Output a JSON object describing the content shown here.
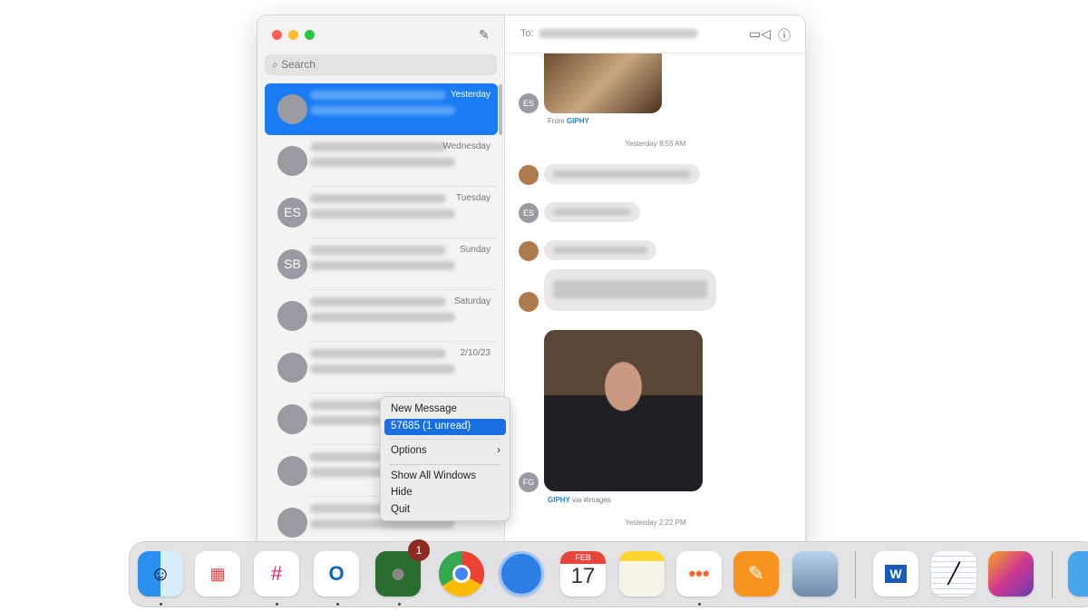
{
  "sidebar": {
    "search_placeholder": "Search",
    "conversations": [
      {
        "date": "Yesterday",
        "avatar": "",
        "selected": true
      },
      {
        "date": "Wednesday",
        "avatar": ""
      },
      {
        "date": "Tuesday",
        "avatar": "ES"
      },
      {
        "date": "Sunday",
        "avatar": "SB"
      },
      {
        "date": "Saturday",
        "avatar": ""
      },
      {
        "date": "2/10/23",
        "avatar": ""
      },
      {
        "date": "",
        "avatar": ""
      },
      {
        "date": "",
        "avatar": ""
      },
      {
        "date": "",
        "avatar": ""
      }
    ]
  },
  "header": {
    "to_label": "To:"
  },
  "messages": {
    "sender_es": "ES",
    "sender_fg": "FG",
    "from_prefix": "From",
    "giphy": "GIPHY",
    "via_images": "via #images",
    "ts1": "Yesterday 8:55 AM",
    "ts2": "Yesterday 2:22 PM"
  },
  "context_menu": {
    "items": [
      "New Message",
      "57685 (1 unread)",
      "Options",
      "Show All Windows",
      "Hide",
      "Quit"
    ]
  },
  "dock": {
    "messages_badge": "1",
    "calendar_month": "FEB",
    "calendar_day": "17",
    "apps": [
      "Finder",
      "Launchpad",
      "Slack",
      "Outlook",
      "Messages",
      "Chrome",
      "Signal",
      "Calendar",
      "Notes",
      "Monday",
      "Pages",
      "Preview",
      "Word",
      "TextEdit",
      "Pixelmator",
      "Folder"
    ]
  },
  "colors": {
    "accent": "#1a7cf5",
    "close": "#ff5f57",
    "minimize": "#febc2e",
    "zoom": "#28c840"
  }
}
